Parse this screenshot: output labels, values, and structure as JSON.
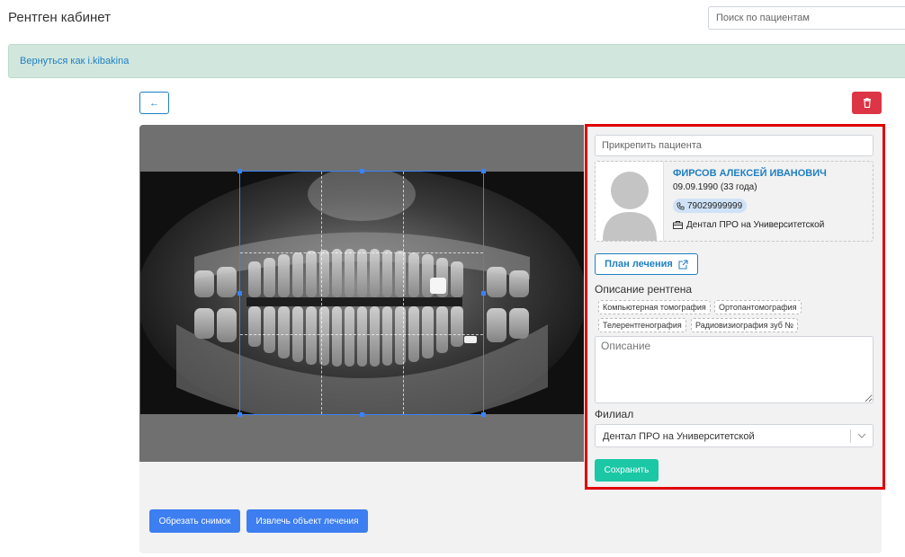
{
  "header": {
    "title": "Рентген кабинет",
    "search_placeholder": "Поиск по пациентам"
  },
  "alert": {
    "link_text": "Вернуться как i.kibakina"
  },
  "toolbar": {
    "back_icon": "arrow-left-icon",
    "delete_icon": "trash-icon"
  },
  "image_tools": {
    "crop_label": "Обрезать снимок",
    "extract_label": "Извлечь объект лечения"
  },
  "panel": {
    "attach_placeholder": "Прикрепить пациента",
    "patient": {
      "name": "ФИРСОВ АЛЕКСЕЙ ИВАНОВИЧ",
      "dob": "09.09.1990 (33 года)",
      "phone": "79029999999",
      "clinic": "Дентал ПРО на Университетской"
    },
    "plan_label": "План лечения",
    "description_label": "Описание рентгена",
    "tags": [
      "Компьютерная томография",
      "Ортопантомография",
      "Телерентгенография",
      "Радиовизиография зуб №"
    ],
    "description_placeholder": "Описание",
    "branch_label": "Филиал",
    "branch_value": "Дентал ПРО на Университетской",
    "save_label": "Сохранить"
  },
  "colors": {
    "primary": "#1f7fc2",
    "danger": "#dc3545",
    "success_bg": "#d1e7dd",
    "save": "#1bc7a5",
    "tool_button": "#3d7ef1",
    "highlight": "#e00000"
  }
}
